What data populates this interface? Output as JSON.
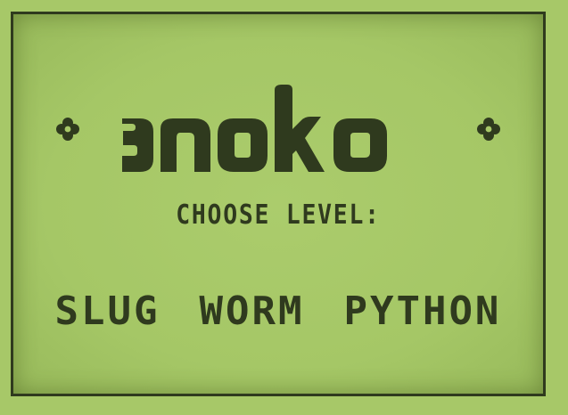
{
  "title": "snake",
  "prompt": "CHOOSE LEVEL:",
  "levels": [
    {
      "label": "SLUG"
    },
    {
      "label": "WORM"
    },
    {
      "label": "PYTHON"
    }
  ],
  "icons": {
    "left": "flower-icon",
    "right": "flower-icon"
  },
  "colors": {
    "background": "#a7c868",
    "ink": "#2f3a1e"
  }
}
